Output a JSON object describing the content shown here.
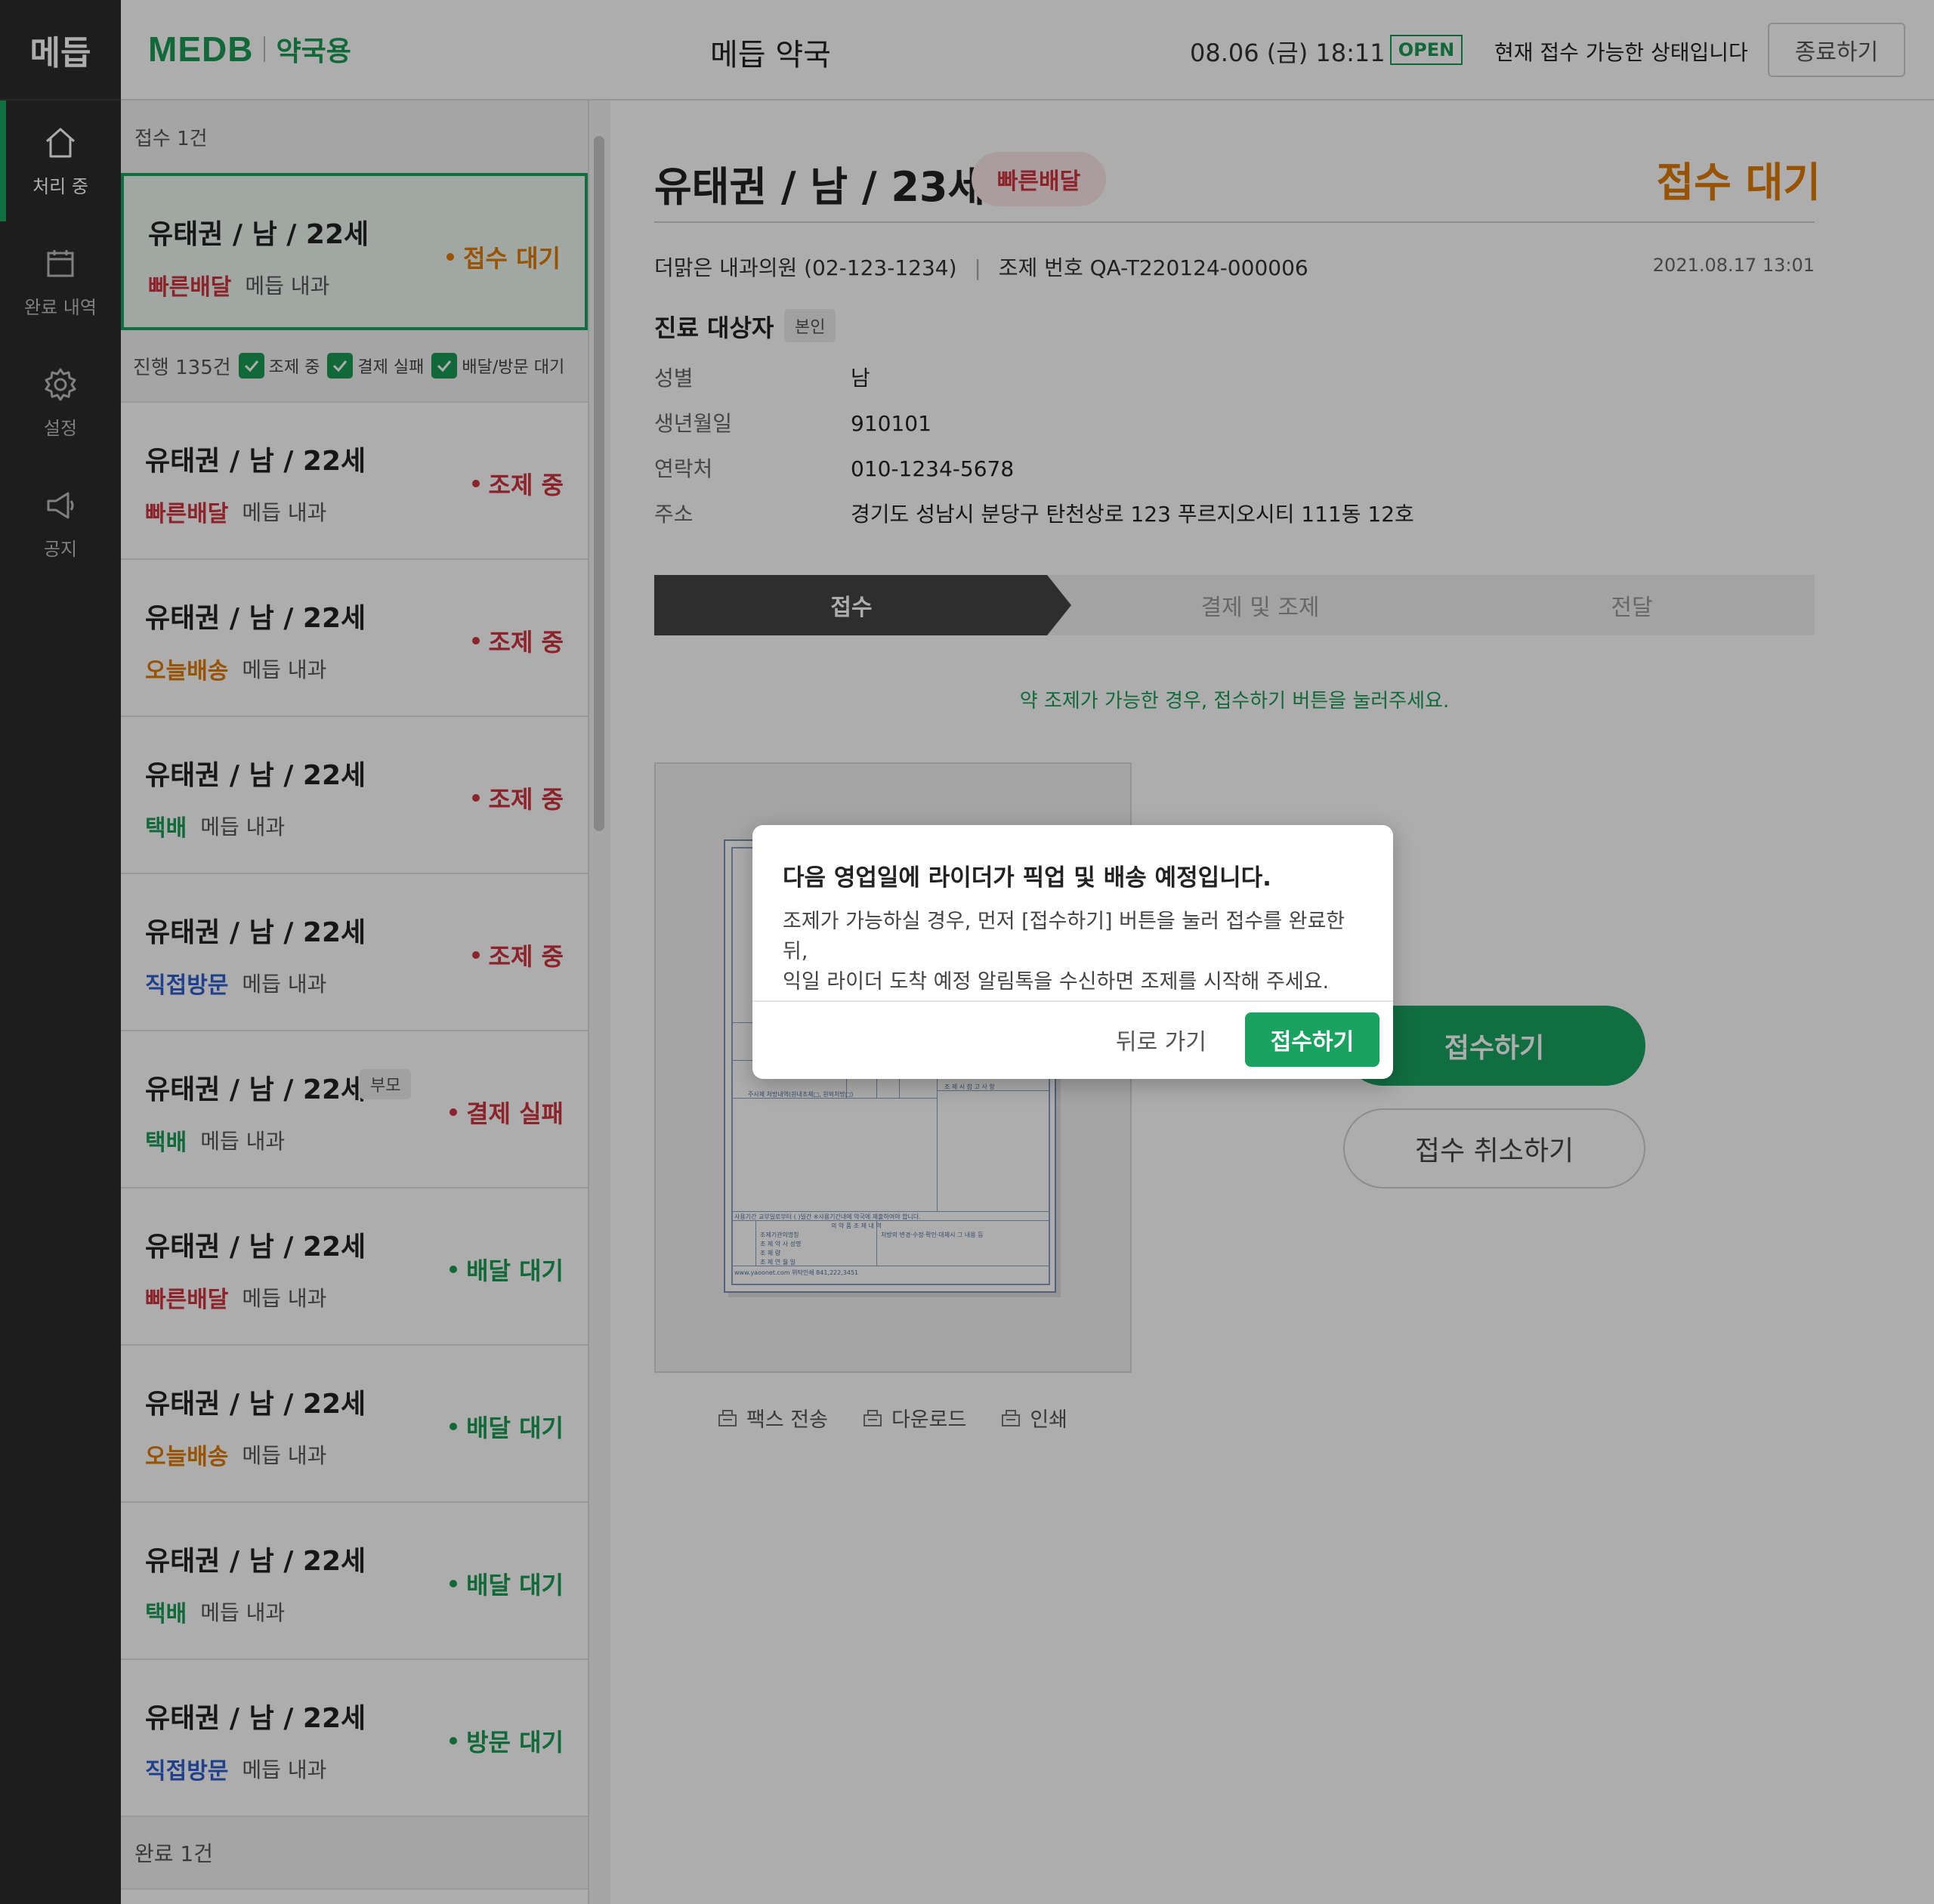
{
  "rail": {
    "logo": "메듭",
    "items": [
      {
        "label": "처리 중",
        "icon": "home-icon"
      },
      {
        "label": "완료 내역",
        "icon": "calendar-icon"
      },
      {
        "label": "설정",
        "icon": "gear-icon"
      },
      {
        "label": "공지",
        "icon": "megaphone-icon"
      }
    ]
  },
  "header": {
    "brand_main": "MEDB",
    "brand_sub": "약국용",
    "pharmacy_name": "메듭 약국",
    "datetime": "08.06 (금) 18:11",
    "open_badge": "OPEN",
    "status_text": "현재 접수 가능한 상태입니다",
    "end_button": "종료하기"
  },
  "queue": {
    "received_header": "접수 1건",
    "progress_header": "진행 135건",
    "filters": [
      "조제 중",
      "결제 실패",
      "배달/방문 대기"
    ],
    "completed_header": "완료 1건",
    "cards": [
      {
        "name": "유태권 / 남 / 22세",
        "delivery": "빠른배달",
        "delivery_color": "#d0343f",
        "dept": "메듭 내과",
        "status": "접수 대기",
        "status_color": "#e07b00",
        "tag": ""
      },
      {
        "name": "유태권 / 남 / 22세",
        "delivery": "빠른배달",
        "delivery_color": "#d0343f",
        "dept": "메듭 내과",
        "status": "조제 중",
        "status_color": "#d0343f",
        "tag": ""
      },
      {
        "name": "유태권 / 남 / 22세",
        "delivery": "오늘배송",
        "delivery_color": "#e07b00",
        "dept": "메듭 내과",
        "status": "조제 중",
        "status_color": "#d0343f",
        "tag": ""
      },
      {
        "name": "유태권 / 남 / 22세",
        "delivery": "택배",
        "delivery_color": "#1a9b55",
        "dept": "메듭 내과",
        "status": "조제 중",
        "status_color": "#d0343f",
        "tag": ""
      },
      {
        "name": "유태권 / 남 / 22세",
        "delivery": "직접방문",
        "delivery_color": "#2f5fd0",
        "dept": "메듭 내과",
        "status": "조제 중",
        "status_color": "#d0343f",
        "tag": ""
      },
      {
        "name": "유태권 / 남 / 22세",
        "delivery": "택배",
        "delivery_color": "#1a9b55",
        "dept": "메듭 내과",
        "status": "결제 실패",
        "status_color": "#d0343f",
        "tag": "부모"
      },
      {
        "name": "유태권 / 남 / 22세",
        "delivery": "빠른배달",
        "delivery_color": "#d0343f",
        "dept": "메듭 내과",
        "status": "배달 대기",
        "status_color": "#1a9b55",
        "tag": ""
      },
      {
        "name": "유태권 / 남 / 22세",
        "delivery": "오늘배송",
        "delivery_color": "#e07b00",
        "dept": "메듭 내과",
        "status": "배달 대기",
        "status_color": "#1a9b55",
        "tag": ""
      },
      {
        "name": "유태권 / 남 / 22세",
        "delivery": "택배",
        "delivery_color": "#1a9b55",
        "dept": "메듭 내과",
        "status": "배달 대기",
        "status_color": "#1a9b55",
        "tag": ""
      },
      {
        "name": "유태권 / 남 / 22세",
        "delivery": "직접방문",
        "delivery_color": "#2f5fd0",
        "dept": "메듭 내과",
        "status": "방문 대기",
        "status_color": "#1a9b55",
        "tag": ""
      }
    ]
  },
  "detail": {
    "title": "유태권 / 남 / 23세",
    "delivery_badge": "빠른배달",
    "status": "접수 대기",
    "clinic": "더맑은 내과의원 (02-123-1234)",
    "rx_number": "조제 번호 QA-T220124-000006",
    "timestamp": "2021.08.17  13:01",
    "patient_title": "진료 대상자",
    "patient_relation": "본인",
    "info": [
      {
        "label": "성별",
        "value": "남"
      },
      {
        "label": "생년월일",
        "value": "910101"
      },
      {
        "label": "연락처",
        "value": "010-1234-5678"
      },
      {
        "label": "주소",
        "value": "경기도 성남시 분당구 탄천상로 123 푸르지오시티 111동 12호"
      }
    ],
    "steps": [
      "접수",
      "결제 및 조제",
      "전달"
    ],
    "hint": "약 조제가 가능한 경우, 접수하기 버튼을 눌러주세요.",
    "rx_actions": [
      "팩스 전송",
      "다운로드",
      "인쇄"
    ],
    "accept_button": "접수하기",
    "cancel_button": "접수 취소하기"
  },
  "modal": {
    "title": "다음 영업일에 라이더가 픽업 및 배송 예정입니다.",
    "body_line1": "조제가 가능하실 경우, 먼저 [접수하기] 버튼을 눌러 접수를 완료한 뒤,",
    "body_line2": "익일 라이더 도착 예정 알림톡을 수신하면 조제를 시작해 주세요.",
    "back_button": "뒤로 가기",
    "accept_button": "접수하기"
  }
}
